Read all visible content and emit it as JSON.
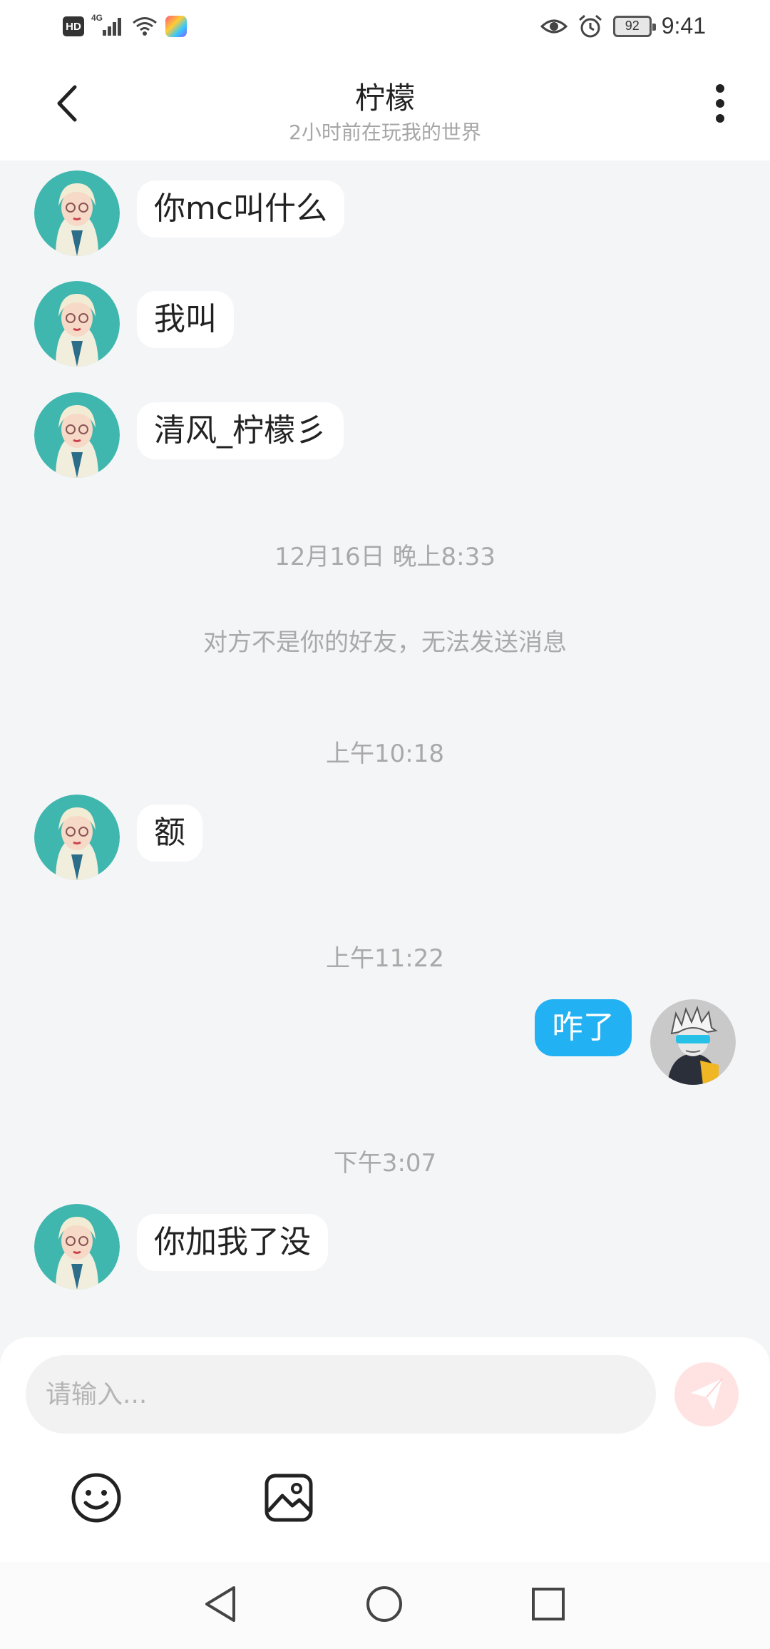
{
  "status_bar": {
    "left_icons": [
      "hd-icon",
      "cellular-4g-signal-icon",
      "wifi-icon",
      "app-notification-icon"
    ],
    "hd_label": "HD",
    "network_label": "4G",
    "right_icons": [
      "eye-icon",
      "alarm-icon",
      "battery-icon"
    ],
    "battery": "92",
    "time": "9:41"
  },
  "header": {
    "title": "柠檬",
    "subtitle": "2小时前在玩我的世界",
    "back_icon": "chevron-left-icon",
    "more_icon": "more-vertical-icon"
  },
  "messages": [
    {
      "type": "incoming",
      "text": "你mc叫什么"
    },
    {
      "type": "incoming",
      "text": "我叫"
    },
    {
      "type": "incoming",
      "text": "清风_柠檬彡"
    },
    {
      "type": "timestamp",
      "text": "12月16日 晚上8:33"
    },
    {
      "type": "system",
      "text": "对方不是你的好友，无法发送消息"
    },
    {
      "type": "timestamp",
      "text": "上午10:18"
    },
    {
      "type": "incoming",
      "text": "额"
    },
    {
      "type": "timestamp",
      "text": "上午11:22"
    },
    {
      "type": "outgoing",
      "text": "咋了"
    },
    {
      "type": "timestamp",
      "text": "下午3:07"
    },
    {
      "type": "incoming",
      "text": "你加我了没"
    }
  ],
  "composer": {
    "placeholder": "请输入...",
    "value": "",
    "send_icon": "paper-plane-icon",
    "tools": [
      "emoji-icon",
      "image-icon"
    ]
  },
  "nav_bar": {
    "buttons": [
      "back-triangle-icon",
      "home-circle-icon",
      "recents-square-icon"
    ]
  },
  "colors": {
    "background": "#f4f5f7",
    "outgoing_bubble": "#22b1f2",
    "incoming_bubble": "#ffffff",
    "send_button": "#ffe3e3",
    "muted_text": "#a9a9a9"
  }
}
